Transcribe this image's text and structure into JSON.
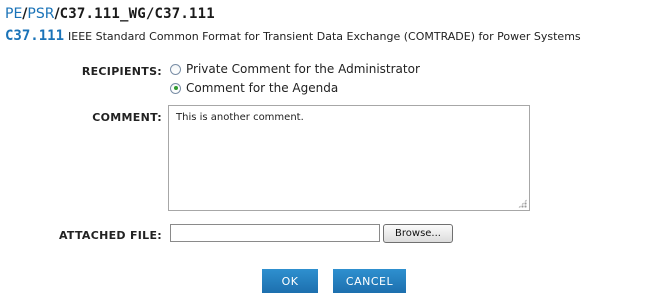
{
  "breadcrumb": {
    "part1": "PE",
    "sep1": "/",
    "part2": "PSR",
    "sep2": "/",
    "current": "C37.111_WG/C37.111"
  },
  "standard": {
    "code": "C37.111",
    "title": "IEEE Standard Common Format for Transient Data Exchange (COMTRADE) for Power Systems"
  },
  "form": {
    "recipients_label": "RECIPIENTS:",
    "recipient_options": [
      {
        "label": "Private Comment for the Administrator",
        "selected": false
      },
      {
        "label": "Comment for the Agenda",
        "selected": true
      }
    ],
    "comment_label": "COMMENT:",
    "comment_value": "This is another comment.",
    "attached_file_label": "ATTACHED FILE:",
    "file_value": "",
    "browse_label": "Browse..."
  },
  "actions": {
    "ok_label": "OK",
    "cancel_label": "CANCEL"
  },
  "colors": {
    "link": "#1a73b8",
    "button_top": "#2e90cf",
    "button_bottom": "#1d6fae",
    "radio_checked": "#2f9a2f"
  }
}
